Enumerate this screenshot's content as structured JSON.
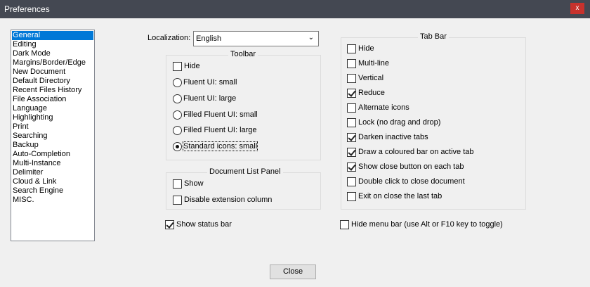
{
  "window": {
    "title": "Preferences",
    "close_label": "x"
  },
  "sidebar": {
    "items": [
      {
        "label": "General",
        "selected": true
      },
      {
        "label": "Editing"
      },
      {
        "label": "Dark Mode"
      },
      {
        "label": "Margins/Border/Edge"
      },
      {
        "label": "New Document"
      },
      {
        "label": "Default Directory"
      },
      {
        "label": "Recent Files History"
      },
      {
        "label": "File Association"
      },
      {
        "label": "Language"
      },
      {
        "label": "Highlighting"
      },
      {
        "label": "Print"
      },
      {
        "label": "Searching"
      },
      {
        "label": "Backup"
      },
      {
        "label": "Auto-Completion"
      },
      {
        "label": "Multi-Instance"
      },
      {
        "label": "Delimiter"
      },
      {
        "label": "Cloud & Link"
      },
      {
        "label": "Search Engine"
      },
      {
        "label": "MISC."
      }
    ]
  },
  "localization": {
    "label": "Localization:",
    "value": "English"
  },
  "toolbar": {
    "title": "Toolbar",
    "hide": {
      "label": "Hide",
      "checked": false
    },
    "options": [
      {
        "label": "Fluent UI: small",
        "checked": false
      },
      {
        "label": "Fluent UI: large",
        "checked": false
      },
      {
        "label": "Filled Fluent UI: small",
        "checked": false
      },
      {
        "label": "Filled Fluent UI: large",
        "checked": false
      },
      {
        "label": "Standard icons: small",
        "checked": true
      }
    ]
  },
  "doc_list_panel": {
    "title": "Document List Panel",
    "show": {
      "label": "Show",
      "checked": false
    },
    "disable_ext": {
      "label": "Disable extension column",
      "checked": false
    }
  },
  "status_bar": {
    "label": "Show status bar",
    "checked": true
  },
  "tab_bar": {
    "title": "Tab Bar",
    "options": [
      {
        "label": "Hide",
        "checked": false
      },
      {
        "label": "Multi-line",
        "checked": false
      },
      {
        "label": "Vertical",
        "checked": false
      },
      {
        "label": "Reduce",
        "checked": true
      },
      {
        "label": "Alternate icons",
        "checked": false
      },
      {
        "label": "Lock (no drag and drop)",
        "checked": false
      },
      {
        "label": "Darken inactive tabs",
        "checked": true
      },
      {
        "label": "Draw a coloured bar on active tab",
        "checked": true
      },
      {
        "label": "Show close button on each tab",
        "checked": true
      },
      {
        "label": "Double click to close document",
        "checked": false
      },
      {
        "label": "Exit on close the last tab",
        "checked": false
      }
    ]
  },
  "menu_bar": {
    "label": "Hide menu bar (use Alt or F10 key to toggle)",
    "checked": false
  },
  "close_button": {
    "label": "Close"
  }
}
